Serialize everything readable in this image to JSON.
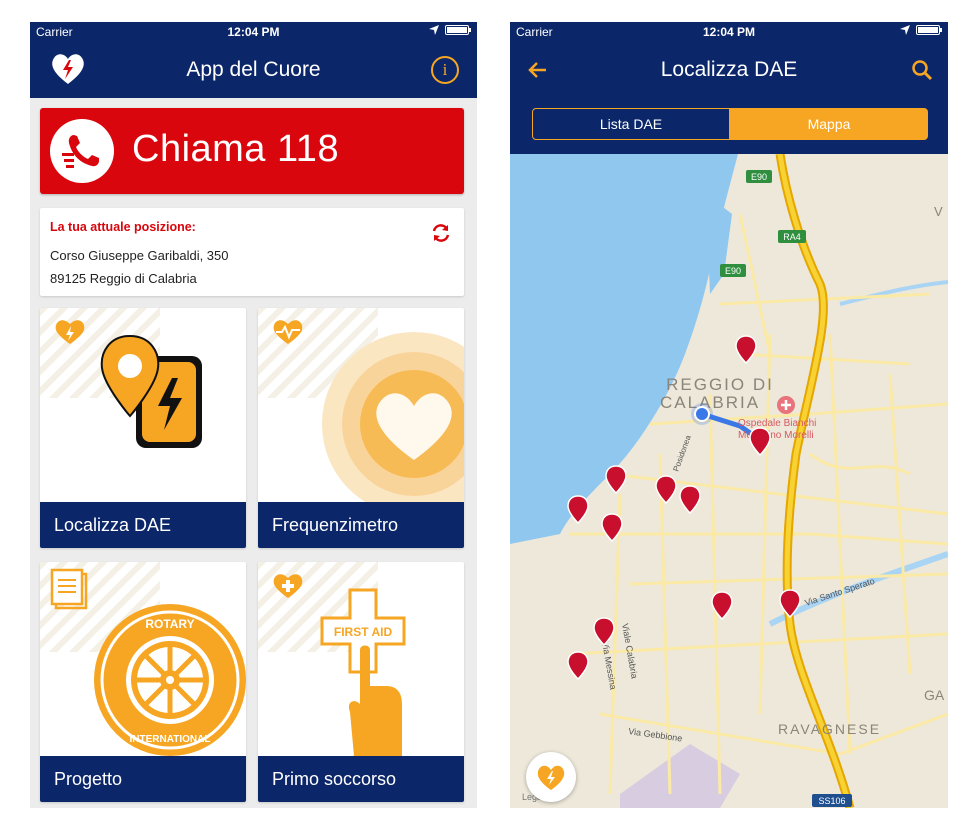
{
  "status_bar": {
    "carrier": "Carrier",
    "time": "12:04 PM"
  },
  "home": {
    "title": "App del Cuore",
    "call_button_label": "Chiama 118",
    "position": {
      "heading": "La tua attuale posizione:",
      "address_line1": "Corso Giuseppe Garibaldi, 350",
      "address_line2": "89125 Reggio di Calabria"
    },
    "tiles": [
      {
        "label": "Localizza DAE"
      },
      {
        "label": "Frequenzimetro"
      },
      {
        "label": "Progetto"
      },
      {
        "label": "Primo soccorso"
      }
    ],
    "first_aid_sign": "FIRST AID",
    "rotary_text": {
      "top": "ROTARY",
      "bottom": "INTERNATIONAL"
    }
  },
  "dae": {
    "title": "Localizza DAE",
    "segments": {
      "list": "Lista DAE",
      "map": "Mappa"
    },
    "map_labels": {
      "city": "REGGIO DI",
      "city2": "CALABRIA",
      "hospital1": "Ospedale Bianchi",
      "hospital2": "Melacrino Morelli",
      "road_e90_top": "E90",
      "road_e90_mid": "E90",
      "road_ra4": "RA4",
      "road_ss106": "SS106",
      "ravagnese": "RAVAGNESE",
      "via_santo_sperato": "Via Santo Sperato",
      "via_gebbione": "Via Gebbione",
      "viale_calabria": "Viale Calabria",
      "via_messina": "Via Messina",
      "posidonea": "Posidonea",
      "edge_v": "V",
      "edge_ga": "GA",
      "legal": "Legal"
    }
  },
  "colors": {
    "navy": "#0b2669",
    "red": "#d9060e",
    "orange": "#f6a623",
    "sea": "#8fc7ef",
    "land": "#ede8da",
    "road": "#fbe9a6",
    "highway": "#f2c315",
    "pin": "#c8102e"
  }
}
